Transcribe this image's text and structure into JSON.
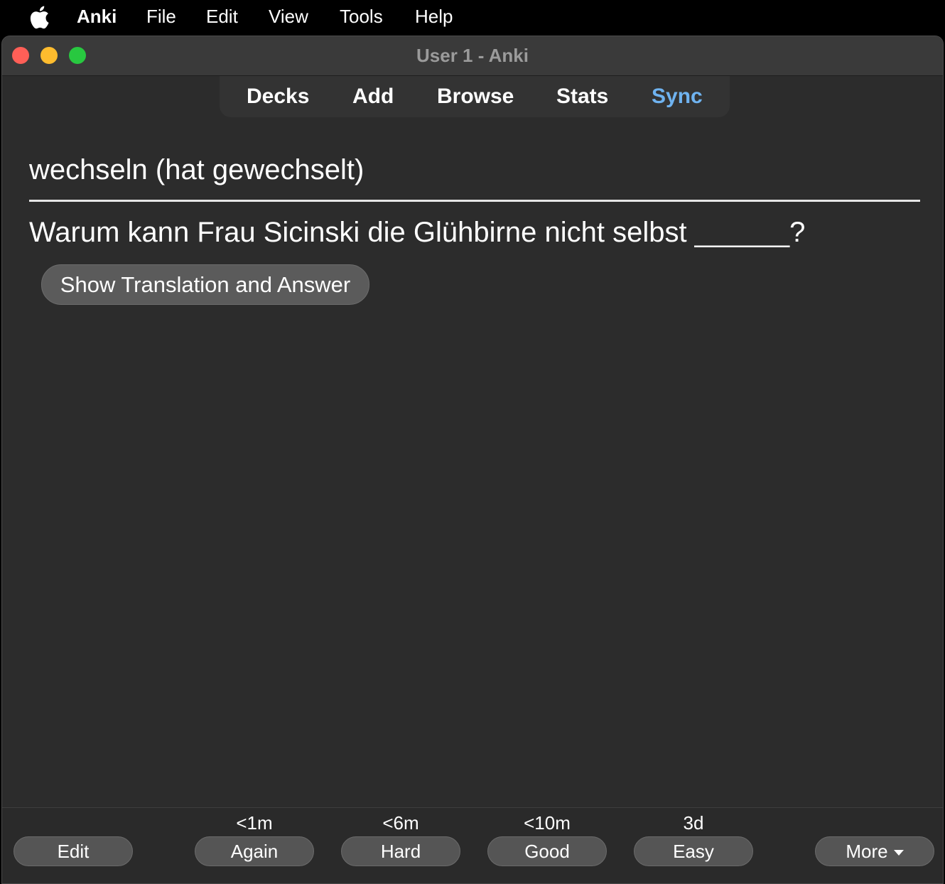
{
  "menubar": {
    "items": [
      "Anki",
      "File",
      "Edit",
      "View",
      "Tools",
      "Help"
    ],
    "apple_icon": "apple-icon"
  },
  "window": {
    "title": "User 1 - Anki"
  },
  "toolbar": {
    "items": [
      "Decks",
      "Add",
      "Browse",
      "Stats",
      "Sync"
    ],
    "sync_color": "#6fb3f0"
  },
  "card": {
    "front": "wechseln (hat gewechselt)",
    "question": "Warum kann Frau Sicinski die Glühbirne nicht selbst ______?",
    "show_button": "Show Translation and Answer"
  },
  "bottom": {
    "edit_label": "Edit",
    "answers": [
      {
        "interval": "<1m",
        "label": "Again"
      },
      {
        "interval": "<6m",
        "label": "Hard"
      },
      {
        "interval": "<10m",
        "label": "Good"
      },
      {
        "interval": "3d",
        "label": "Easy"
      }
    ],
    "more_label": "More",
    "more_icon": "caret-down-icon"
  }
}
